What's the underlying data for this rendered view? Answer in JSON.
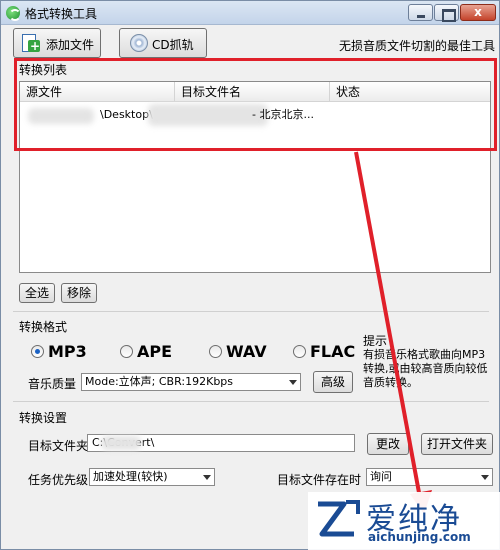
{
  "window": {
    "title": "格式转换工具",
    "controls": {
      "close": "x"
    }
  },
  "toolbar": {
    "add_label": "添加文件",
    "cd_label": "CD抓轨",
    "slogan": "无损音质文件切割的最佳工具"
  },
  "list": {
    "caption": "转换列表",
    "columns": [
      "源文件",
      "目标文件名",
      "状态"
    ],
    "rows": [
      {
        "source": "\\Desktop\\",
        "target": "- 北京北京...",
        "status": ""
      }
    ],
    "select_all": "全选",
    "remove": "移除"
  },
  "format": {
    "caption": "转换格式",
    "options": [
      "MP3",
      "APE",
      "WAV",
      "FLAC"
    ],
    "selected": "MP3",
    "quality_label": "音乐质量",
    "quality_value": "Mode:立体声; CBR:192Kbps",
    "advanced": "高级",
    "tip_title": "提示",
    "tip_text": "有损音乐格式歌曲向MP3转换,或由较高音质向较低音质转换。"
  },
  "settings": {
    "caption": "转换设置",
    "target_folder_label": "目标文件夹",
    "target_folder_value": "C:\\Convert\\",
    "change": "更改",
    "open_folder": "打开文件夹",
    "priority_label": "任务优先级",
    "priority_value": "加速处理(较快)",
    "exists_label": "目标文件存在时",
    "exists_value": "询问"
  },
  "watermark": {
    "title": "爱纯净",
    "url": "aichunjing.com"
  },
  "colors": {
    "highlight_box": "#e0202a",
    "arrow": "#e0202a",
    "radio_dot": "#1b62c4",
    "watermark": "#1a4b94"
  }
}
